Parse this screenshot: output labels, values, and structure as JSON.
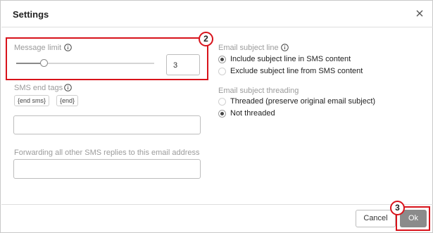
{
  "dialog": {
    "title": "Settings"
  },
  "message_limit": {
    "label": "Message limit",
    "value": "3",
    "slider_fraction": 0.2
  },
  "sms_end_tags": {
    "label": "SMS end tags",
    "tags": [
      "{end sms}",
      "{end}"
    ],
    "input_value": ""
  },
  "forwarding": {
    "label": "Forwarding all other SMS replies to this email address",
    "input_value": ""
  },
  "email_subject_line": {
    "label": "Email subject line",
    "options": [
      {
        "label": "Include subject line in SMS content",
        "selected": true
      },
      {
        "label": "Exclude subject line from SMS content",
        "selected": false
      }
    ]
  },
  "email_subject_threading": {
    "label": "Email subject threading",
    "options": [
      {
        "label": "Threaded (preserve original email subject)",
        "selected": false
      },
      {
        "label": "Not threaded",
        "selected": true
      }
    ]
  },
  "annotations": {
    "badge_2": "2",
    "badge_3": "3"
  },
  "footer": {
    "cancel_label": "Cancel",
    "ok_label": "Ok"
  },
  "colors": {
    "annotation": "#d8131b",
    "primary_button": "#8b8b8b"
  },
  "icons": {
    "close": "close-icon",
    "info": "info-icon"
  }
}
